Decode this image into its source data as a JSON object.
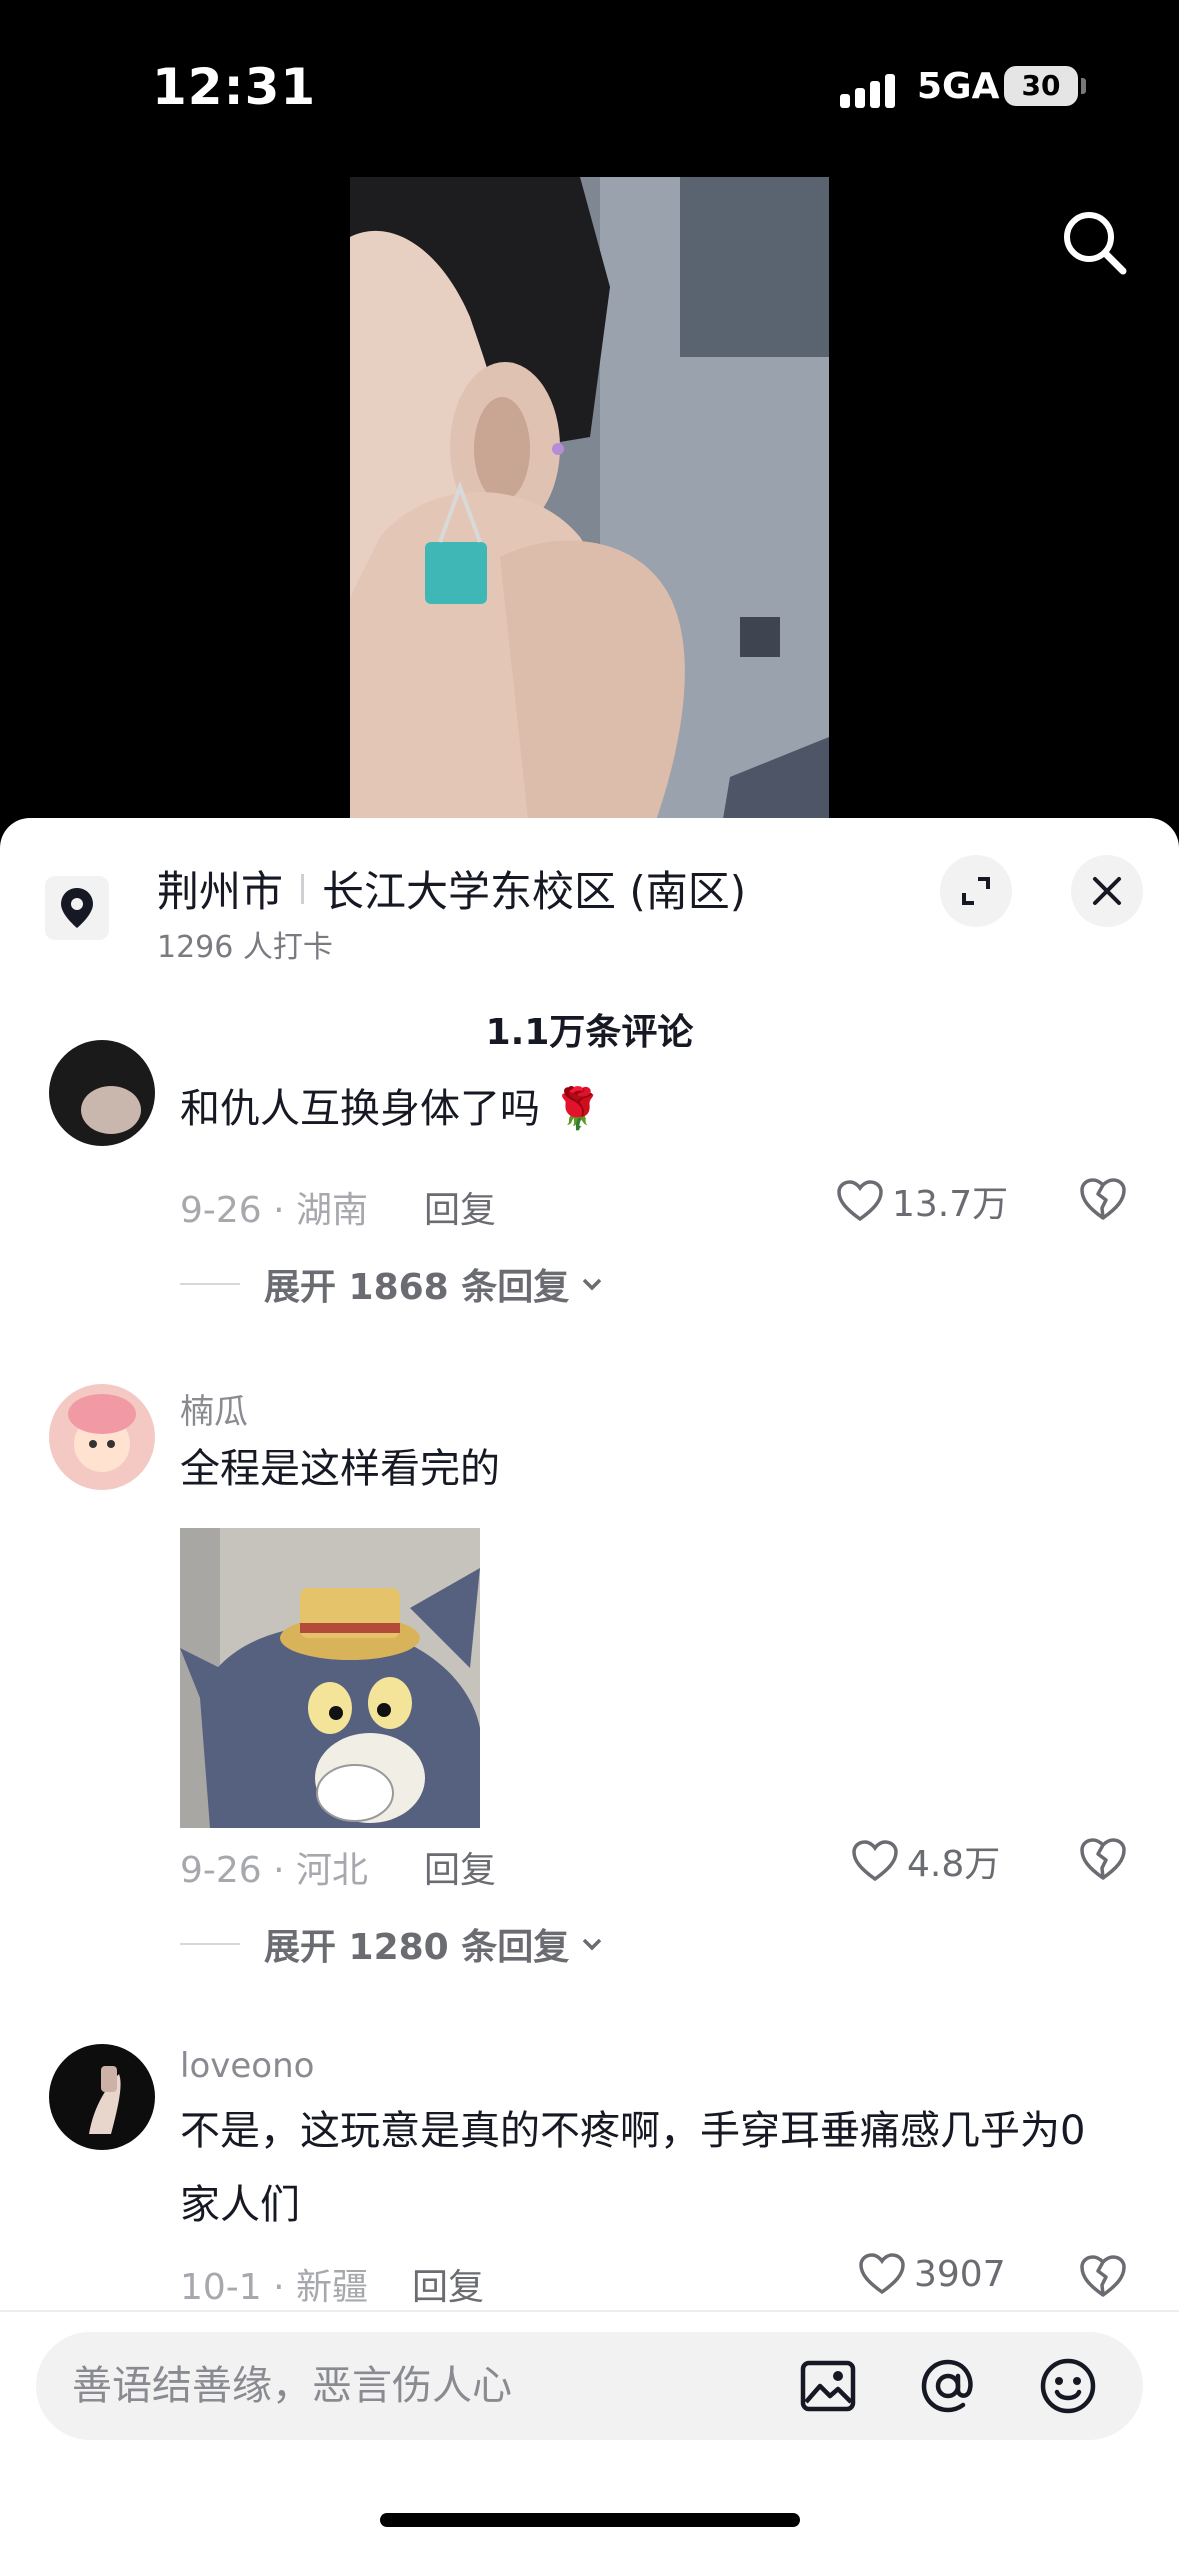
{
  "status_bar": {
    "time": "12:31",
    "network": "5GA",
    "battery": "30"
  },
  "location": {
    "city": "荆州市",
    "place": "长江大学东校区 (南区)",
    "checkins": "1296 人打卡"
  },
  "comments_header": {
    "count_label": "1.1万条评论"
  },
  "comments": [
    {
      "text": "和仇人互换身体了吗 🌹",
      "meta": "9-26 · 湖南",
      "reply_label": "回复",
      "likes": "13.7万",
      "expand_label": "展开 1868 条回复"
    },
    {
      "user": "楠瓜",
      "text": "全程是这样看完的",
      "meta": "9-26 · 河北",
      "reply_label": "回复",
      "likes": "4.8万",
      "expand_label": "展开 1280 条回复"
    },
    {
      "user": "loveono",
      "text": "不是，这玩意是真的不疼啊，手穿耳垂痛感几乎为0家人们",
      "meta": "10-1 · 新疆",
      "reply_label": "回复",
      "likes": "3907"
    }
  ],
  "input": {
    "placeholder": "善语结善缘，恶言伤人心"
  },
  "icons": {
    "search": "search-icon",
    "location": "location-pin-icon",
    "expand": "expand-icon",
    "close": "close-icon",
    "like": "heart-outline-icon",
    "dislike": "broken-heart-icon",
    "image": "image-icon",
    "mention": "at-icon",
    "emoji": "emoji-icon"
  }
}
